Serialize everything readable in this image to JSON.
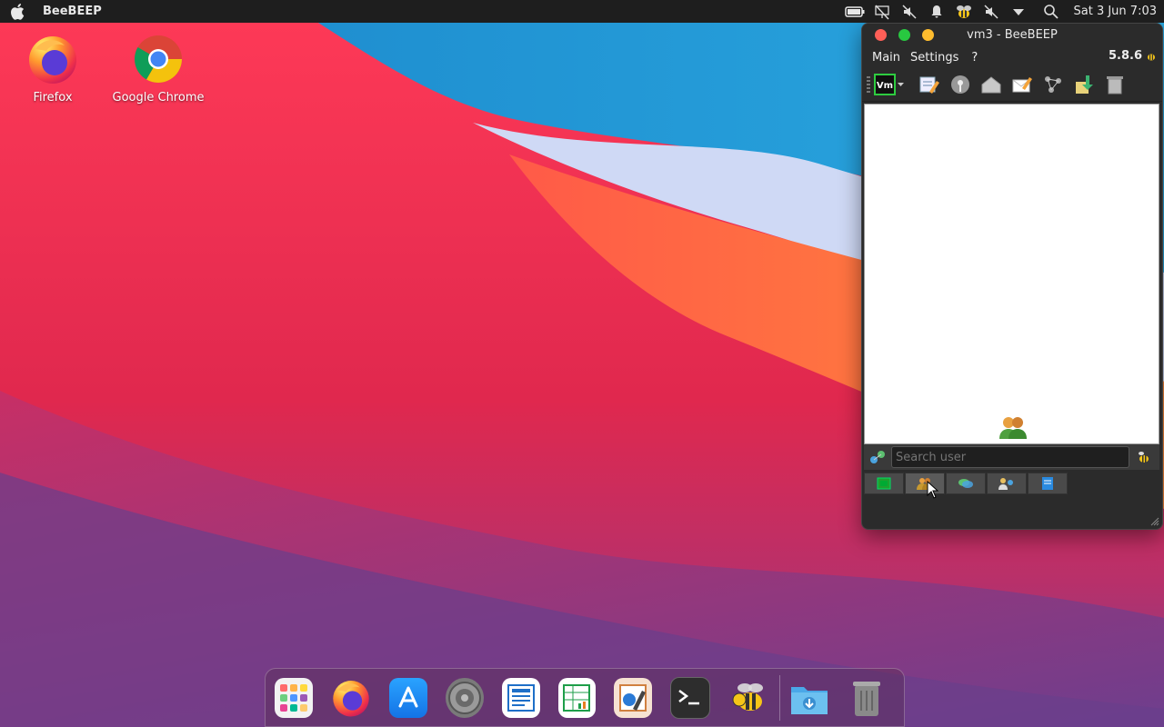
{
  "menubar": {
    "app_name": "BeeBEEP",
    "clock": "Sat 3 Jun 7:03",
    "tray_icons": [
      "battery-icon",
      "network-off-icon",
      "volume-muted-icon",
      "notification-bell-icon",
      "beebeep-tray-icon",
      "volume-off-icon",
      "dropdown-arrow-icon",
      "search-icon"
    ]
  },
  "desktop": {
    "icons": [
      {
        "label": "Firefox",
        "icon": "firefox-icon"
      },
      {
        "label": "Google Chrome",
        "icon": "chrome-icon"
      }
    ]
  },
  "window": {
    "title": "vm3 - BeeBEEP",
    "menus": [
      "Main",
      "Settings",
      "?"
    ],
    "version": "5.8.6",
    "toolbar": [
      {
        "name": "vm-status-button",
        "icon": "vm-icon",
        "text": "Vm"
      },
      {
        "name": "edit-profile-button",
        "icon": "edit-icon"
      },
      {
        "name": "broadcast-button",
        "icon": "broadcast-icon"
      },
      {
        "name": "home-button",
        "icon": "house-icon"
      },
      {
        "name": "compose-message-button",
        "icon": "envelope-pen-icon"
      },
      {
        "name": "network-button",
        "icon": "network-icon"
      },
      {
        "name": "share-button",
        "icon": "share-icon"
      },
      {
        "name": "trash-button",
        "icon": "trash-icon"
      }
    ],
    "search": {
      "placeholder": "Search user"
    },
    "tabs": [
      "users-tab",
      "groups-tab",
      "chats-tab",
      "network-tab",
      "files-tab"
    ],
    "colors": {
      "close": "#ff5f57",
      "minimize": "#28c840",
      "maximize": "#febc2e"
    }
  },
  "dock": {
    "items": [
      "launcher-icon",
      "firefox-icon",
      "app-store-icon",
      "settings-icon",
      "writer-icon",
      "calc-icon",
      "draw-icon",
      "terminal-icon",
      "beebeep-icon",
      "downloads-folder-icon",
      "trash-icon"
    ],
    "running_indicator": "beebeep-icon"
  }
}
